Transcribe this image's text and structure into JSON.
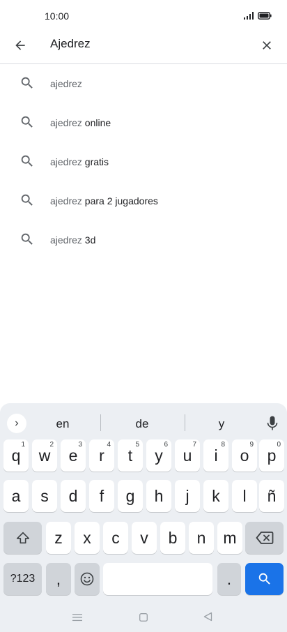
{
  "status_bar": {
    "time": "10:00",
    "signal_icon": "signal-icon",
    "battery_icon": "battery-icon"
  },
  "search": {
    "query": "Ajedrez",
    "back_icon": "arrow-back-icon",
    "clear_icon": "close-icon"
  },
  "suggestions": [
    {
      "prefix": "ajedrez",
      "rest": ""
    },
    {
      "prefix": "ajedrez",
      "rest": " online"
    },
    {
      "prefix": "ajedrez",
      "rest": " gratis"
    },
    {
      "prefix": "ajedrez",
      "rest": " para 2 jugadores"
    },
    {
      "prefix": "ajedrez",
      "rest": " 3d"
    }
  ],
  "keyboard": {
    "word_suggestions": [
      "en",
      "de",
      "y"
    ],
    "row1": [
      {
        "key": "q",
        "hint": "1"
      },
      {
        "key": "w",
        "hint": "2"
      },
      {
        "key": "e",
        "hint": "3"
      },
      {
        "key": "r",
        "hint": "4"
      },
      {
        "key": "t",
        "hint": "5"
      },
      {
        "key": "y",
        "hint": "6"
      },
      {
        "key": "u",
        "hint": "7"
      },
      {
        "key": "i",
        "hint": "8"
      },
      {
        "key": "o",
        "hint": "9"
      },
      {
        "key": "p",
        "hint": "0"
      }
    ],
    "row2": [
      "a",
      "s",
      "d",
      "f",
      "g",
      "h",
      "j",
      "k",
      "l",
      "ñ"
    ],
    "row3": [
      "z",
      "x",
      "c",
      "v",
      "b",
      "n",
      "m"
    ],
    "symbols_key": "?123",
    "comma_key": ",",
    "period_key": "."
  },
  "colors": {
    "accent": "#1a73e8",
    "keyboard_bg": "#eceff3",
    "dark_key": "#d0d4d9"
  }
}
